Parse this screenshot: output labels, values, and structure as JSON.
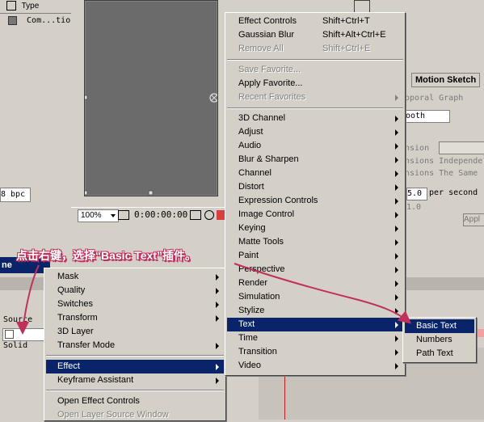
{
  "project_panel": {
    "type_header": "Type",
    "row_item": "Com...tio",
    "bpc": "8 bpc"
  },
  "viewer": {
    "zoom": "100%",
    "timecode": "0:00:00:00"
  },
  "right_panel": {
    "tab_motion_sketch": "Motion Sketch",
    "temporal_graph": "oporal Graph",
    "smooth": "ooth",
    "dimension": "nsion",
    "dimensions_independent": "nsions Independe",
    "dimensions_same": "nsions The Same",
    "rate_value": "5.0",
    "rate_unit": "per second",
    "value_2": "1.0",
    "apply": "Appl"
  },
  "timeline": {
    "tab_partial": "ne",
    "source_header": "Source",
    "layer_name": "Solid"
  },
  "annotation": "点击右键，选择“Basic Text”插件。",
  "effect_menu": {
    "items": [
      {
        "label": "Effect Controls",
        "shortcut": "Shift+Ctrl+T"
      },
      {
        "label": "Gaussian Blur",
        "shortcut": "Shift+Alt+Ctrl+E"
      },
      {
        "label": "Remove All",
        "shortcut": "Shift+Ctrl+E"
      },
      {
        "label": "Save Favorite..."
      },
      {
        "label": "Apply Favorite..."
      },
      {
        "label": "Recent Favorites"
      },
      {
        "label": "3D Channel"
      },
      {
        "label": "Adjust"
      },
      {
        "label": "Audio"
      },
      {
        "label": "Blur & Sharpen"
      },
      {
        "label": "Channel"
      },
      {
        "label": "Distort"
      },
      {
        "label": "Expression Controls"
      },
      {
        "label": "Image Control"
      },
      {
        "label": "Keying"
      },
      {
        "label": "Matte Tools"
      },
      {
        "label": "Paint"
      },
      {
        "label": "Perspective"
      },
      {
        "label": "Render"
      },
      {
        "label": "Simulation"
      },
      {
        "label": "Stylize"
      },
      {
        "label": "Text"
      },
      {
        "label": "Time"
      },
      {
        "label": "Transition"
      },
      {
        "label": "Video"
      }
    ]
  },
  "context_menu": {
    "items": [
      {
        "label": "Mask"
      },
      {
        "label": "Quality"
      },
      {
        "label": "Switches"
      },
      {
        "label": "Transform"
      },
      {
        "label": "3D Layer"
      },
      {
        "label": "Transfer Mode"
      },
      {
        "label": "Effect"
      },
      {
        "label": "Keyframe Assistant"
      },
      {
        "label": "Open Effect Controls"
      },
      {
        "label": "Open Layer Source Window"
      }
    ]
  },
  "text_submenu": {
    "items": [
      {
        "label": "Basic Text"
      },
      {
        "label": "Numbers"
      },
      {
        "label": "Path Text"
      }
    ]
  },
  "colors": {
    "selection": "#0a246a",
    "annotation_outline": "#c0305a",
    "arrow": "#c0305a"
  }
}
